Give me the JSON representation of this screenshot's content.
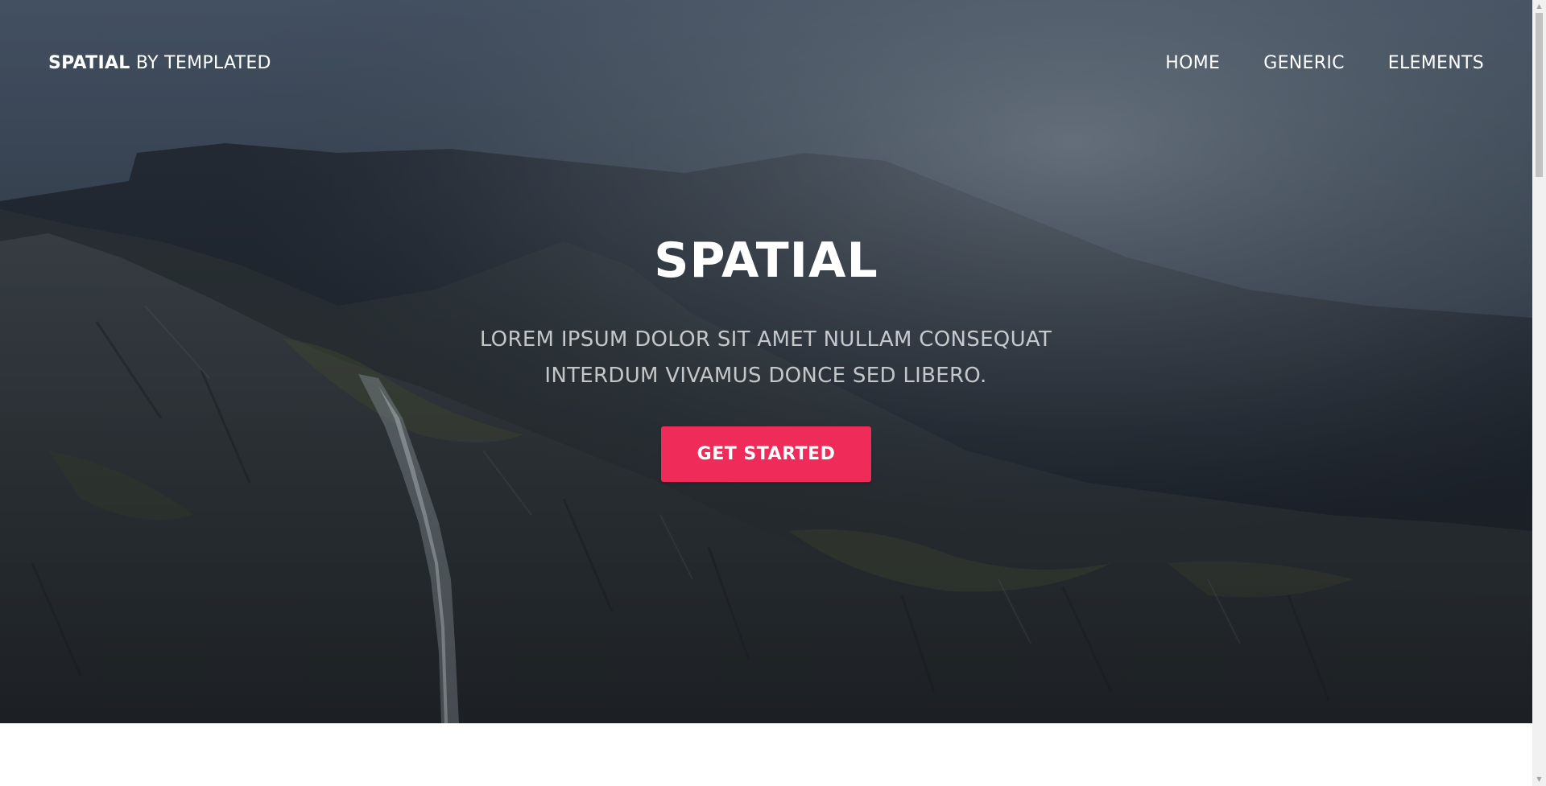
{
  "header": {
    "logo_strong": "SPATIAL",
    "logo_rest": " BY TEMPLATED",
    "nav": [
      {
        "label": "HOME"
      },
      {
        "label": "GENERIC"
      },
      {
        "label": "ELEMENTS"
      }
    ]
  },
  "hero": {
    "title": "SPATIAL",
    "subtitle_line1": "LOREM IPSUM DOLOR SIT AMET NULLAM CONSEQUAT",
    "subtitle_line2": "INTERDUM VIVAMUS DONCE SED LIBERO.",
    "cta_label": "GET STARTED",
    "background_image": "misty-mountain-waterfall-photo"
  },
  "colors": {
    "accent": "#ef2b5a",
    "banner_dark": "#2b3340",
    "text_light": "#ffffff"
  },
  "scrollbar": {
    "up_icon": "chevron-up-icon",
    "down_icon": "chevron-down-icon"
  }
}
